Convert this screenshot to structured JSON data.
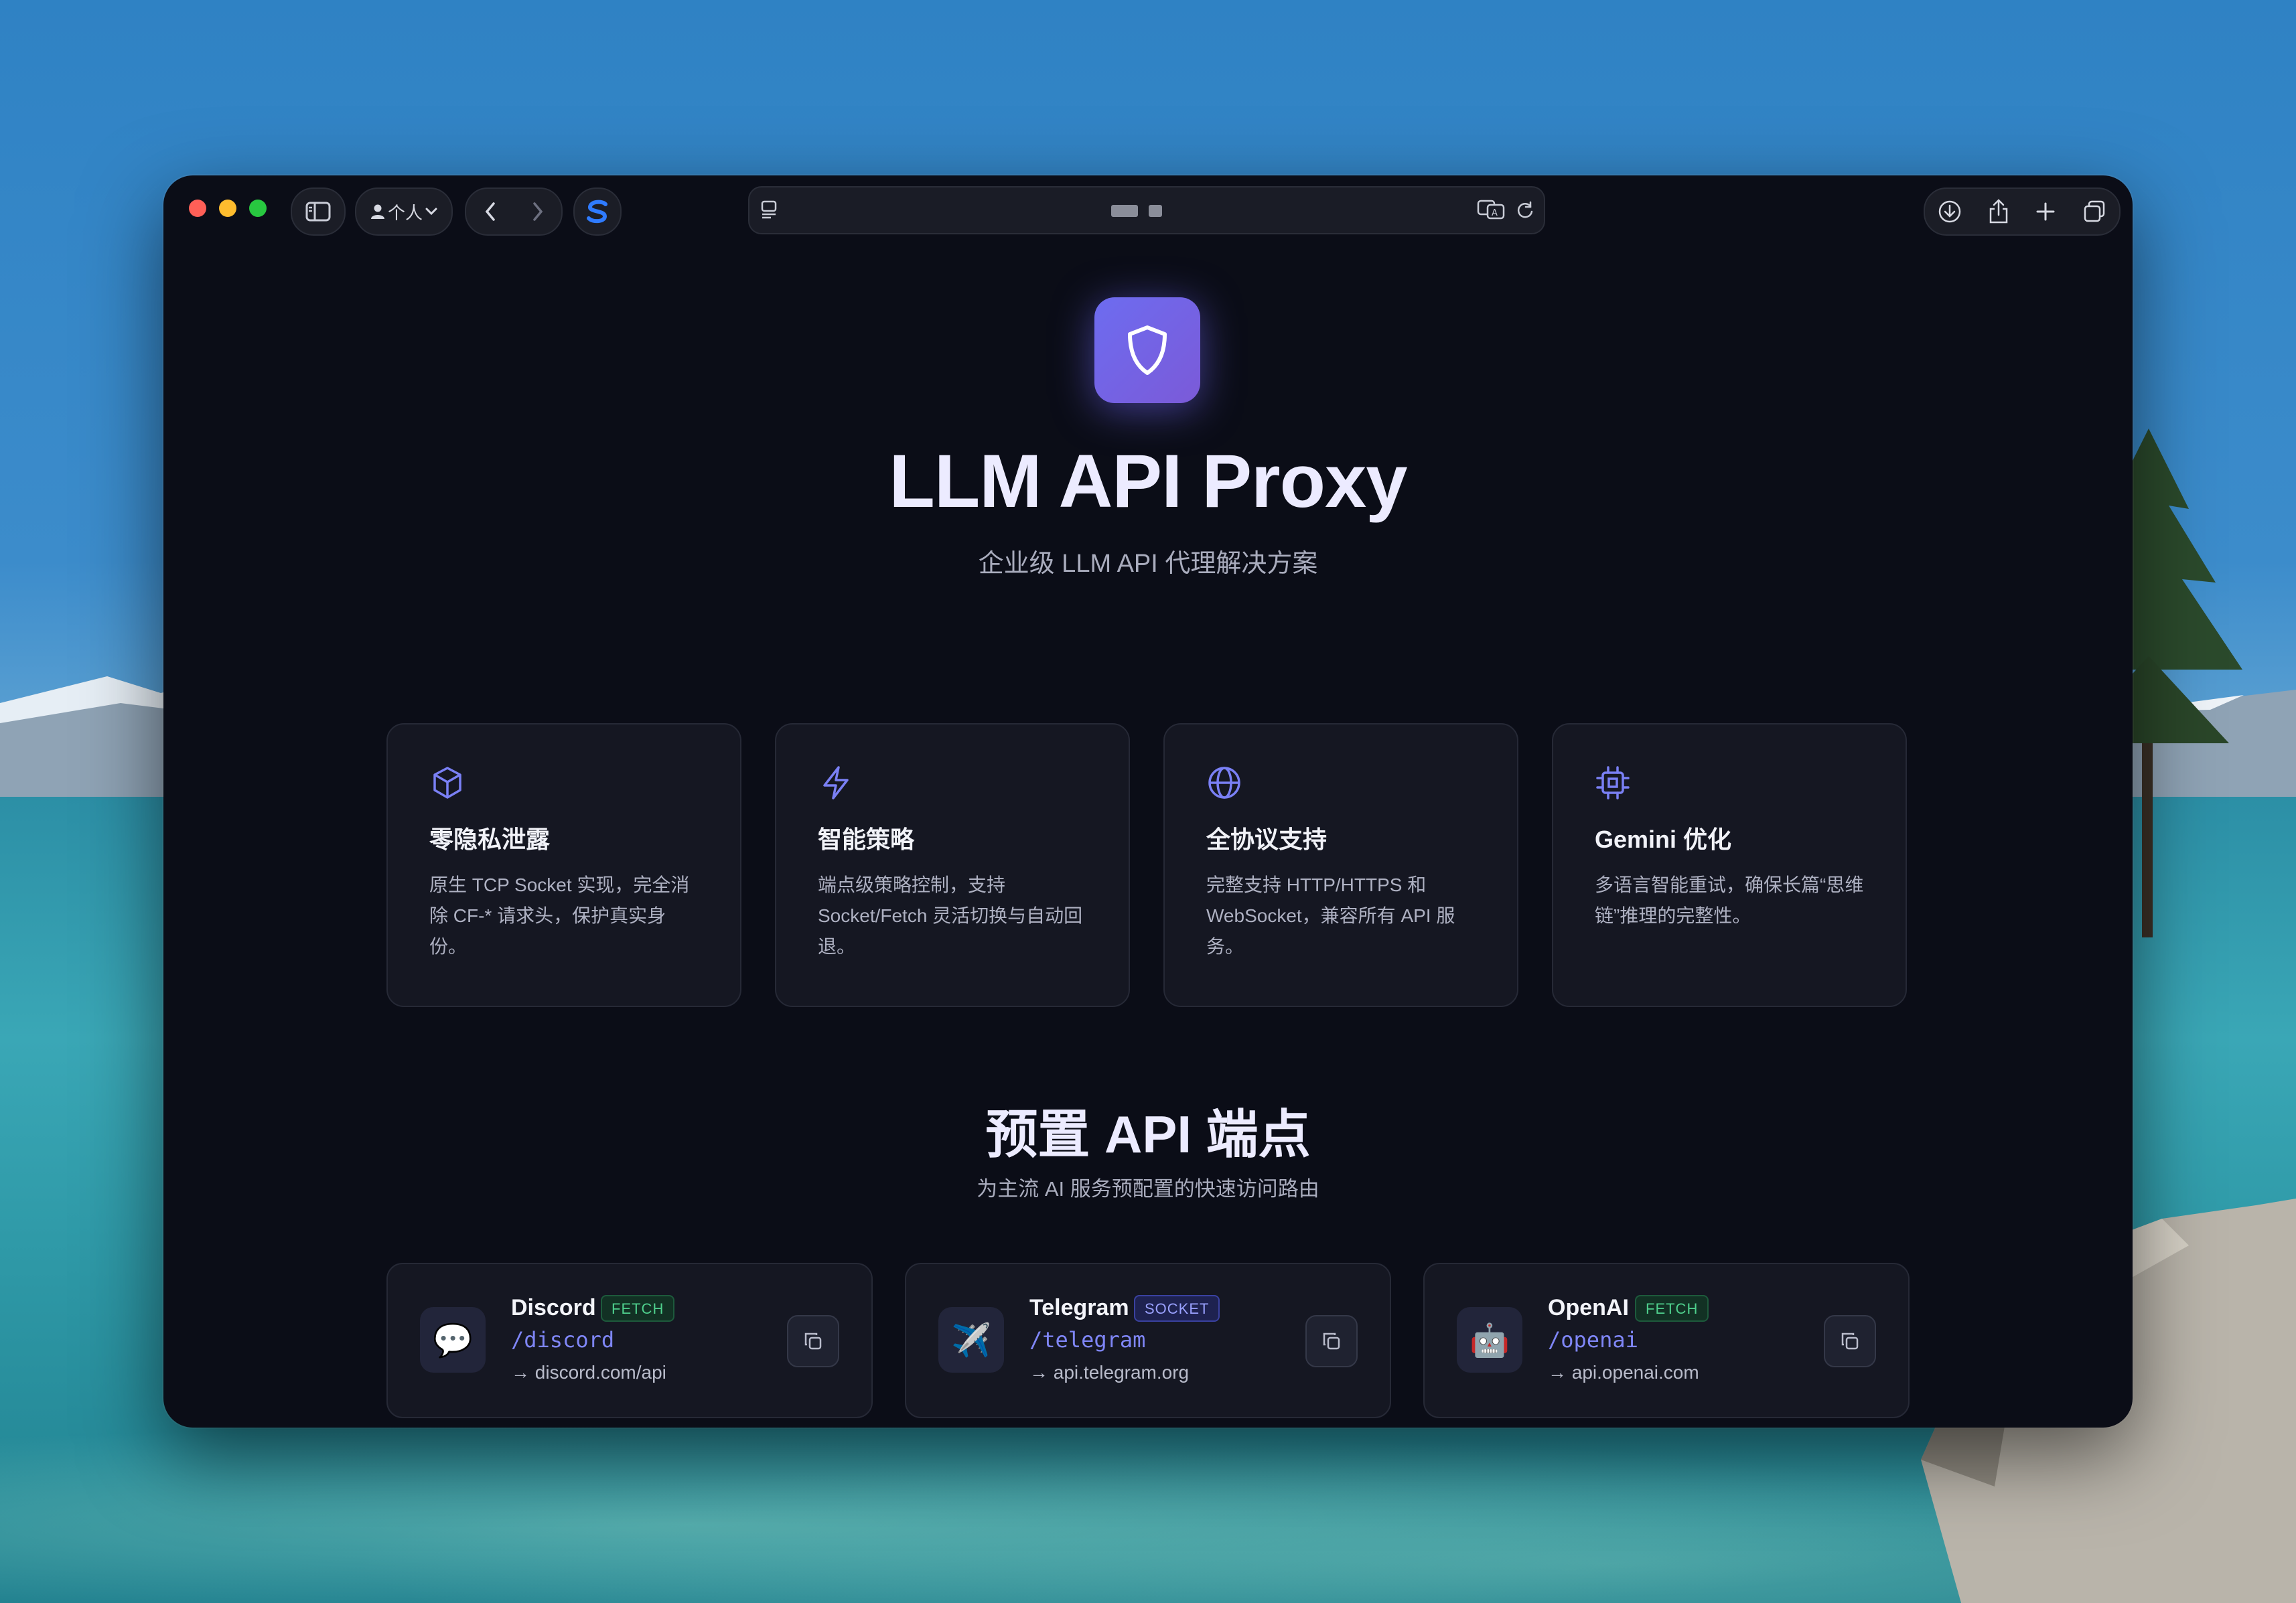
{
  "browser": {
    "profile_label": "个人",
    "url_masked": true
  },
  "hero": {
    "title": "LLM API Proxy",
    "subtitle": "企业级 LLM API 代理解决方案"
  },
  "features": [
    {
      "icon": "cube-icon",
      "title": "零隐私泄露",
      "desc": "原生 TCP Socket 实现，完全消除 CF-* 请求头，保护真实身份。"
    },
    {
      "icon": "lightning-icon",
      "title": "智能策略",
      "desc": "端点级策略控制，支持 Socket/Fetch 灵活切换与自动回退。"
    },
    {
      "icon": "globe-icon",
      "title": "全协议支持",
      "desc": "完整支持 HTTP/HTTPS 和 WebSocket，兼容所有 API 服务。"
    },
    {
      "icon": "chip-icon",
      "title": "Gemini 优化",
      "desc": "多语言智能重试，确保长篇“思维链”推理的完整性。"
    }
  ],
  "endpoints_section": {
    "title": "预置 API 端点",
    "subtitle": "为主流 AI 服务预配置的快速访问路由"
  },
  "endpoints": [
    {
      "icon": "chat-bubble-icon",
      "emoji": "💬",
      "name": "Discord",
      "badge": "FETCH",
      "path": "/discord",
      "target": "→ discord.com/api"
    },
    {
      "icon": "airplane-icon",
      "emoji": "✈️",
      "name": "Telegram",
      "badge": "SOCKET",
      "path": "/telegram",
      "target": "→ api.telegram.org"
    },
    {
      "icon": "robot-icon",
      "emoji": "🤖",
      "name": "OpenAI",
      "badge": "FETCH",
      "path": "/openai",
      "target": "→ api.openai.com"
    }
  ],
  "colors": {
    "accent": "#7a80f5",
    "window_bg": "#0b0d17",
    "card_bg": "#151722",
    "fetch_badge": "#4fd08d",
    "socket_badge": "#9aa1ff"
  }
}
